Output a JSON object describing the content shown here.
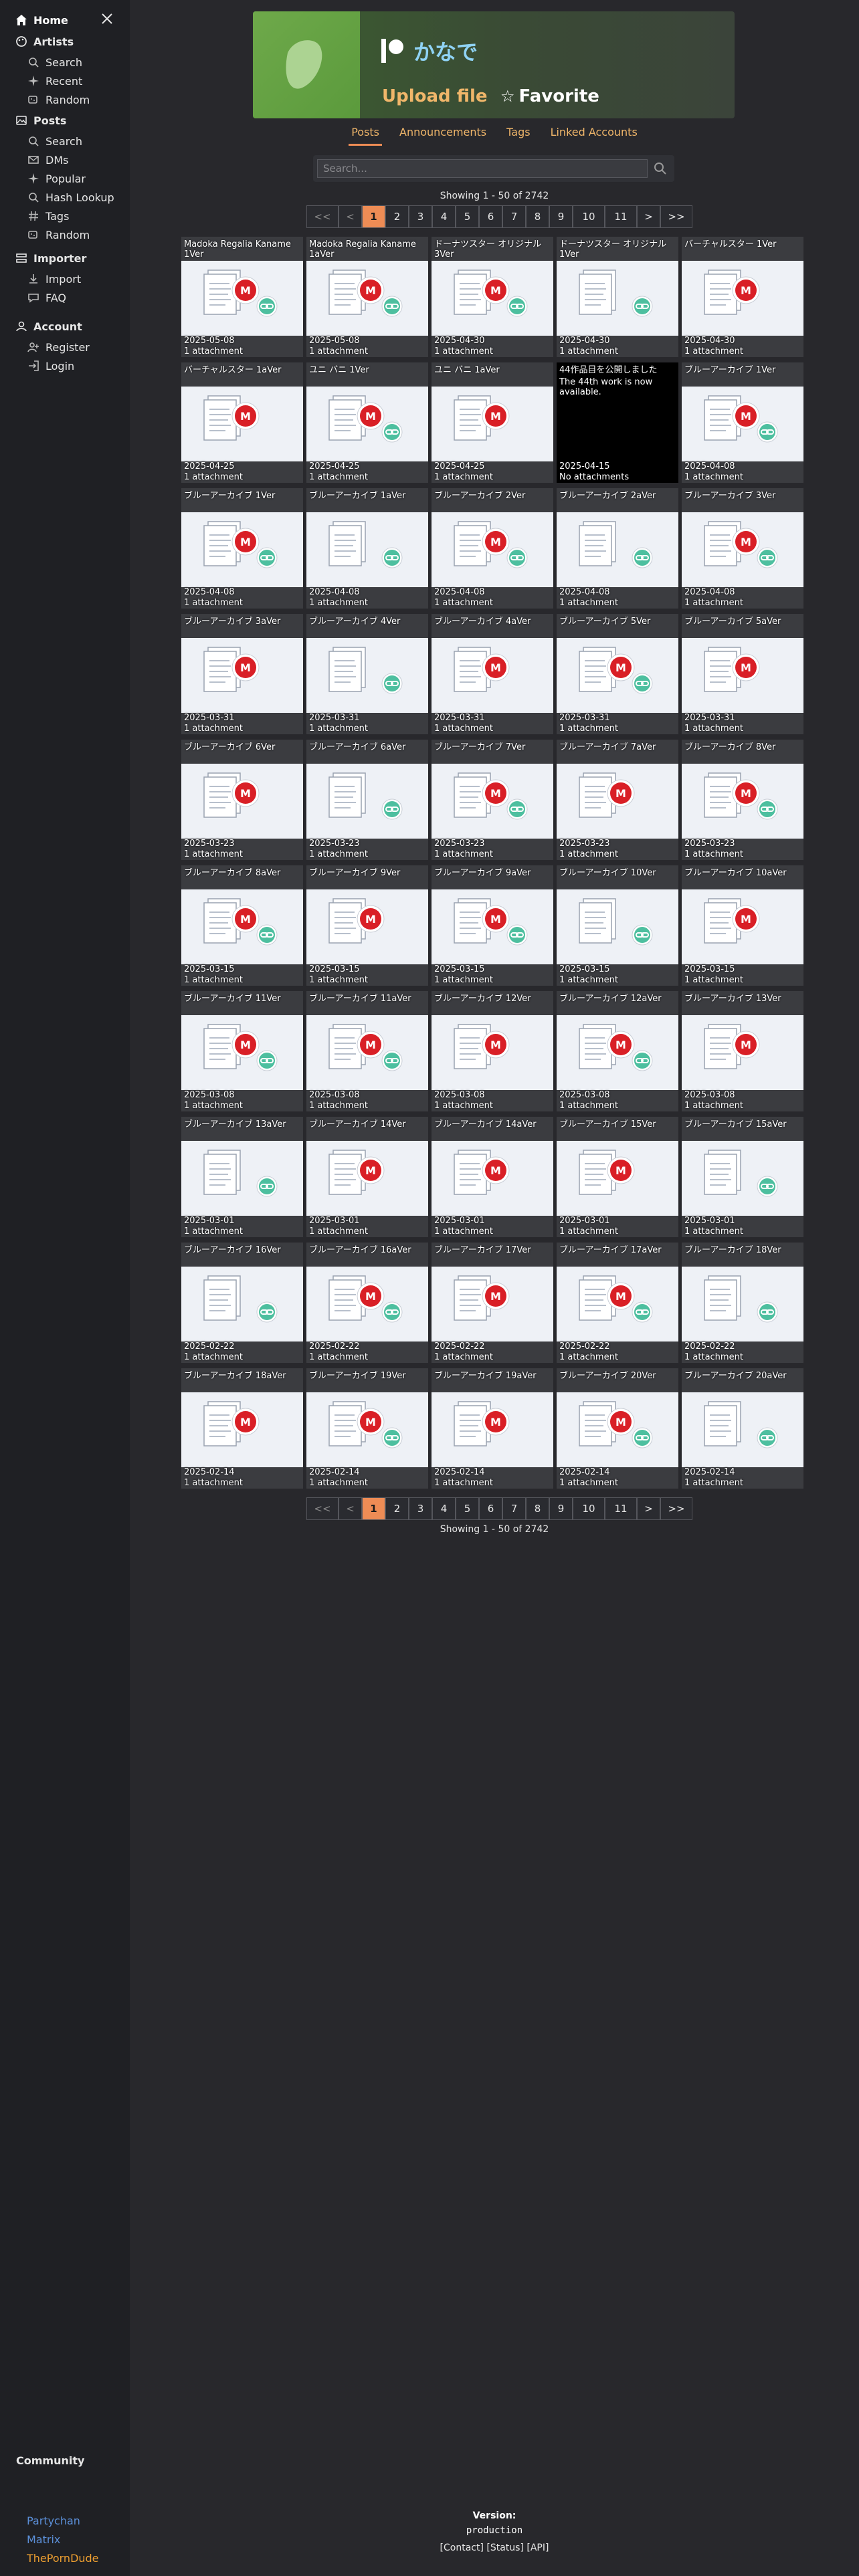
{
  "sidebar": {
    "home": "Home",
    "sections": [
      {
        "title": "Artists",
        "icon": "palette-icon",
        "items": [
          {
            "label": "Search",
            "icon": "search-icon"
          },
          {
            "label": "Recent",
            "icon": "sparkle-icon"
          },
          {
            "label": "Random",
            "icon": "dice-icon"
          }
        ]
      },
      {
        "title": "Posts",
        "icon": "images-icon",
        "items": [
          {
            "label": "Search",
            "icon": "search-icon"
          },
          {
            "label": "DMs",
            "icon": "envelope-icon"
          },
          {
            "label": "Popular",
            "icon": "sparkle-icon"
          },
          {
            "label": "Hash Lookup",
            "icon": "search-icon"
          },
          {
            "label": "Tags",
            "icon": "hash-icon"
          },
          {
            "label": "Random",
            "icon": "dice-icon"
          }
        ]
      },
      {
        "title": "Importer",
        "icon": "importer-icon",
        "items": [
          {
            "label": "Import",
            "icon": "import-icon"
          },
          {
            "label": "FAQ",
            "icon": "faq-icon"
          }
        ]
      },
      {
        "title": "Account",
        "icon": "account-icon",
        "items": [
          {
            "label": "Register",
            "icon": "register-icon"
          },
          {
            "label": "Login",
            "icon": "login-icon"
          }
        ]
      }
    ],
    "community": "Community",
    "community_links": [
      {
        "label": "Partychan",
        "color": "#5b8fd8"
      },
      {
        "label": "Matrix",
        "color": "#5b8fd8"
      },
      {
        "label": "ThePornDude",
        "color": "#f0a030"
      }
    ]
  },
  "artist": {
    "name": "かなで",
    "service_icon": "patreon-icon",
    "upload_label": "Upload file",
    "favorite_label": "Favorite",
    "favorite_icon": "star-icon"
  },
  "tabs": [
    {
      "label": "Posts",
      "active": true
    },
    {
      "label": "Announcements",
      "active": false
    },
    {
      "label": "Tags",
      "active": false
    },
    {
      "label": "Linked Accounts",
      "active": false
    }
  ],
  "search": {
    "placeholder": "Search..."
  },
  "showing": "Showing 1 - 50 of 2742",
  "pagination": [
    "<<",
    "<",
    "1",
    "2",
    "3",
    "4",
    "5",
    "6",
    "7",
    "8",
    "9",
    "10",
    "11",
    ">",
    ">>"
  ],
  "current_page": "1",
  "posts": [
    {
      "title": "Madoka Regalia Kaname 1Ver",
      "date": "2025-05-08",
      "att": "1 attachment",
      "icons": "mega+link"
    },
    {
      "title": "Madoka Regalia Kaname 1aVer",
      "date": "2025-05-08",
      "att": "1 attachment",
      "icons": "mega+link"
    },
    {
      "title": "ドーナツスター オリジナル 3Ver",
      "date": "2025-04-30",
      "att": "1 attachment",
      "icons": "mega+link"
    },
    {
      "title": "ドーナツスター オリジナル 1Ver",
      "date": "2025-04-30",
      "att": "1 attachment",
      "icons": "link"
    },
    {
      "title": "バーチャルスター 1Ver",
      "date": "2025-04-30",
      "att": "1 attachment",
      "icons": "mega"
    },
    {
      "title": "バーチャルスター 1aVer",
      "date": "2025-04-25",
      "att": "1 attachment",
      "icons": "mega"
    },
    {
      "title": "ユニ バニ 1Ver",
      "date": "2025-04-25",
      "att": "1 attachment",
      "icons": "mega+link"
    },
    {
      "title": "ユニ バニ 1aVer",
      "date": "2025-04-25",
      "att": "1 attachment",
      "icons": "mega"
    },
    {
      "title": "44作品目を公開しました",
      "body": "The 44th work is now available.",
      "date": "2025-04-15",
      "att": "No attachments",
      "text": true
    },
    {
      "title": "ブルーアーカイブ 1Ver",
      "date": "2025-04-08",
      "att": "1 attachment",
      "icons": "mega+link"
    },
    {
      "title": "ブルーアーカイブ 1Ver",
      "date": "2025-04-08",
      "att": "1 attachment",
      "icons": "mega+link"
    },
    {
      "title": "ブルーアーカイブ 1aVer",
      "date": "2025-04-08",
      "att": "1 attachment",
      "icons": "link"
    },
    {
      "title": "ブルーアーカイブ 2Ver",
      "date": "2025-04-08",
      "att": "1 attachment",
      "icons": "mega+link"
    },
    {
      "title": "ブルーアーカイブ 2aVer",
      "date": "2025-04-08",
      "att": "1 attachment",
      "icons": "link"
    },
    {
      "title": "ブルーアーカイブ 3Ver",
      "date": "2025-04-08",
      "att": "1 attachment",
      "icons": "mega+link"
    },
    {
      "title": "ブルーアーカイブ 3aVer",
      "date": "2025-03-31",
      "att": "1 attachment",
      "icons": "mega"
    },
    {
      "title": "ブルーアーカイブ 4Ver",
      "date": "2025-03-31",
      "att": "1 attachment",
      "icons": "link"
    },
    {
      "title": "ブルーアーカイブ 4aVer",
      "date": "2025-03-31",
      "att": "1 attachment",
      "icons": "mega"
    },
    {
      "title": "ブルーアーカイブ 5Ver",
      "date": "2025-03-31",
      "att": "1 attachment",
      "icons": "mega+link"
    },
    {
      "title": "ブルーアーカイブ 5aVer",
      "date": "2025-03-31",
      "att": "1 attachment",
      "icons": "mega"
    },
    {
      "title": "ブルーアーカイブ 6Ver",
      "date": "2025-03-23",
      "att": "1 attachment",
      "icons": "mega"
    },
    {
      "title": "ブルーアーカイブ 6aVer",
      "date": "2025-03-23",
      "att": "1 attachment",
      "icons": "link"
    },
    {
      "title": "ブルーアーカイブ 7Ver",
      "date": "2025-03-23",
      "att": "1 attachment",
      "icons": "mega+link"
    },
    {
      "title": "ブルーアーカイブ 7aVer",
      "date": "2025-03-23",
      "att": "1 attachment",
      "icons": "mega"
    },
    {
      "title": "ブルーアーカイブ 8Ver",
      "date": "2025-03-23",
      "att": "1 attachment",
      "icons": "mega+link"
    },
    {
      "title": "ブルーアーカイブ 8aVer",
      "date": "2025-03-15",
      "att": "1 attachment",
      "icons": "mega+link"
    },
    {
      "title": "ブルーアーカイブ 9Ver",
      "date": "2025-03-15",
      "att": "1 attachment",
      "icons": "mega"
    },
    {
      "title": "ブルーアーカイブ 9aVer",
      "date": "2025-03-15",
      "att": "1 attachment",
      "icons": "mega+link"
    },
    {
      "title": "ブルーアーカイブ 10Ver",
      "date": "2025-03-15",
      "att": "1 attachment",
      "icons": "link"
    },
    {
      "title": "ブルーアーカイブ 10aVer",
      "date": "2025-03-15",
      "att": "1 attachment",
      "icons": "mega"
    },
    {
      "title": "ブルーアーカイブ 11Ver",
      "date": "2025-03-08",
      "att": "1 attachment",
      "icons": "mega+link"
    },
    {
      "title": "ブルーアーカイブ 11aVer",
      "date": "2025-03-08",
      "att": "1 attachment",
      "icons": "mega+link"
    },
    {
      "title": "ブルーアーカイブ 12Ver",
      "date": "2025-03-08",
      "att": "1 attachment",
      "icons": "mega"
    },
    {
      "title": "ブルーアーカイブ 12aVer",
      "date": "2025-03-08",
      "att": "1 attachment",
      "icons": "mega+link"
    },
    {
      "title": "ブルーアーカイブ 13Ver",
      "date": "2025-03-08",
      "att": "1 attachment",
      "icons": "mega"
    },
    {
      "title": "ブルーアーカイブ 13aVer",
      "date": "2025-03-01",
      "att": "1 attachment",
      "icons": "link"
    },
    {
      "title": "ブルーアーカイブ 14Ver",
      "date": "2025-03-01",
      "att": "1 attachment",
      "icons": "mega"
    },
    {
      "title": "ブルーアーカイブ 14aVer",
      "date": "2025-03-01",
      "att": "1 attachment",
      "icons": "mega"
    },
    {
      "title": "ブルーアーカイブ 15Ver",
      "date": "2025-03-01",
      "att": "1 attachment",
      "icons": "mega"
    },
    {
      "title": "ブルーアーカイブ 15aVer",
      "date": "2025-03-01",
      "att": "1 attachment",
      "icons": "link"
    },
    {
      "title": "ブルーアーカイブ 16Ver",
      "date": "2025-02-22",
      "att": "1 attachment",
      "icons": "link"
    },
    {
      "title": "ブルーアーカイブ 16aVer",
      "date": "2025-02-22",
      "att": "1 attachment",
      "icons": "mega+link"
    },
    {
      "title": "ブルーアーカイブ 17Ver",
      "date": "2025-02-22",
      "att": "1 attachment",
      "icons": "mega"
    },
    {
      "title": "ブルーアーカイブ 17aVer",
      "date": "2025-02-22",
      "att": "1 attachment",
      "icons": "mega+link"
    },
    {
      "title": "ブルーアーカイブ 18Ver",
      "date": "2025-02-22",
      "att": "1 attachment",
      "icons": "link"
    },
    {
      "title": "ブルーアーカイブ 18aVer",
      "date": "2025-02-14",
      "att": "1 attachment",
      "icons": "mega"
    },
    {
      "title": "ブルーアーカイブ 19Ver",
      "date": "2025-02-14",
      "att": "1 attachment",
      "icons": "mega+link"
    },
    {
      "title": "ブルーアーカイブ 19aVer",
      "date": "2025-02-14",
      "att": "1 attachment",
      "icons": "mega"
    },
    {
      "title": "ブルーアーカイブ 20Ver",
      "date": "2025-02-14",
      "att": "1 attachment",
      "icons": "mega+link"
    },
    {
      "title": "ブルーアーカイブ 20aVer",
      "date": "2025-02-14",
      "att": "1 attachment",
      "icons": "link"
    }
  ],
  "footer": {
    "version_label": "Version:",
    "version_value": "production",
    "contact": "[Contact]",
    "status": "[Status]",
    "api": "[API]"
  }
}
